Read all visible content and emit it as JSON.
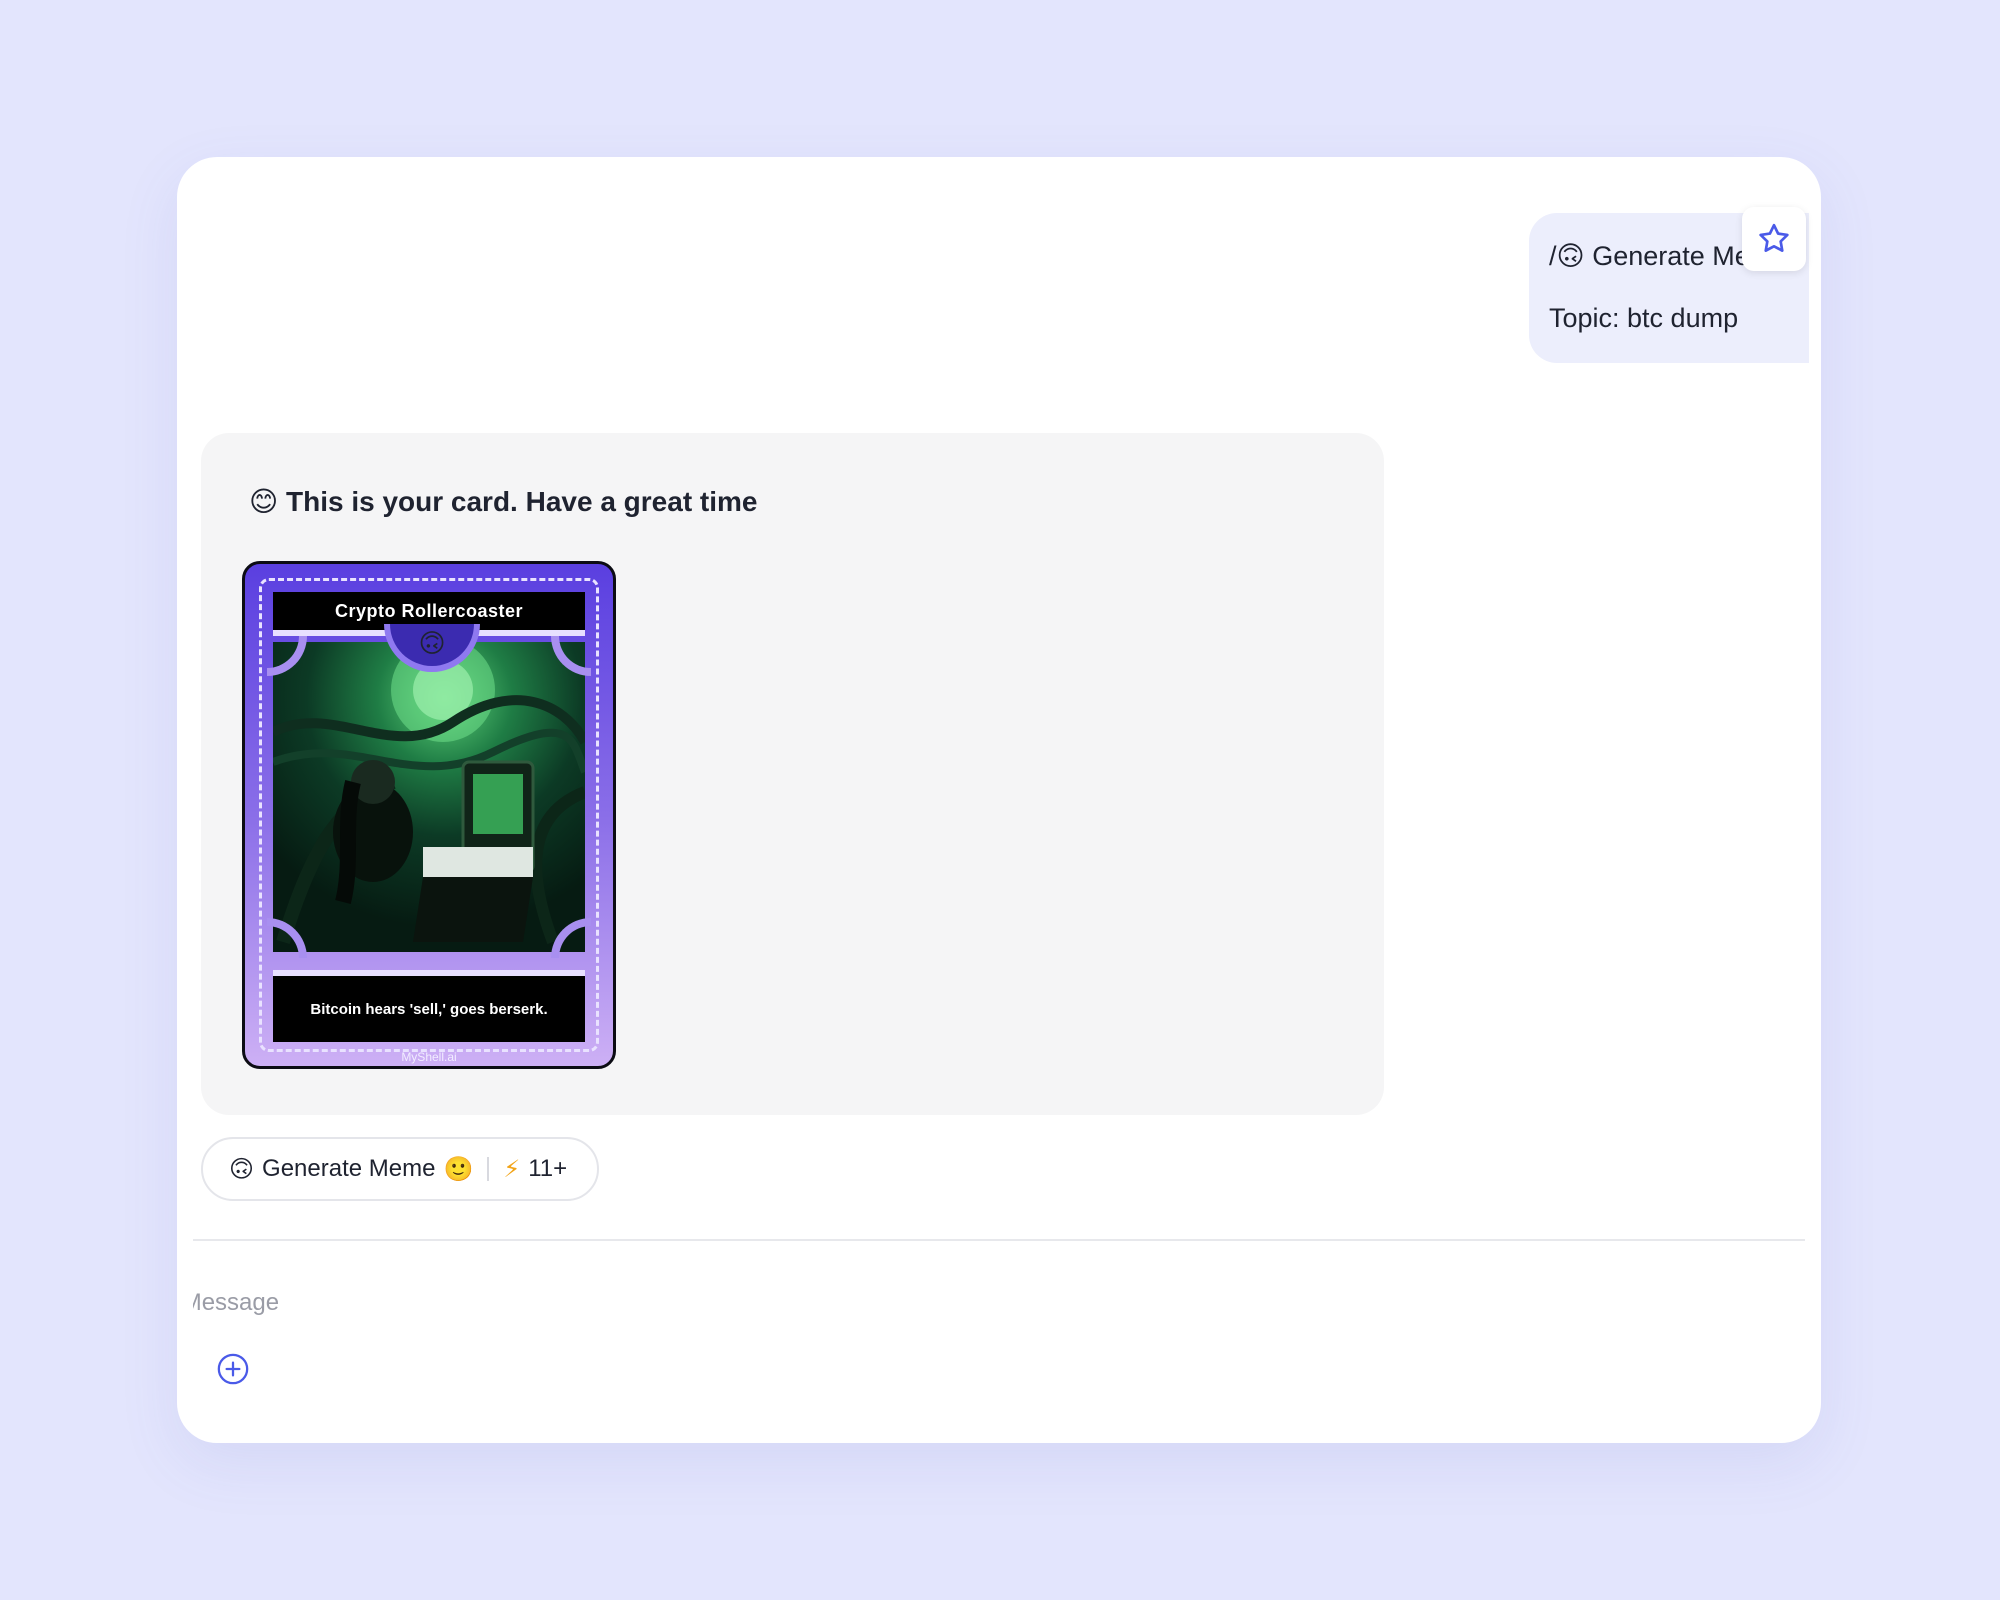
{
  "user_message": {
    "command_prefix": "/",
    "command_emoji": "🙃",
    "command_text": "Generate Meme",
    "topic_line": "Topic: btc dump"
  },
  "star_button": {
    "icon": "star-icon"
  },
  "bot_message": {
    "emoji": "😊",
    "text": "This is your card. Have a great time",
    "card": {
      "title": "Crypto Rollercoaster",
      "emblem_emoji": "🙃",
      "caption": "Bitcoin hears 'sell,' goes berserk.",
      "watermark": "MyShell.ai"
    }
  },
  "chip": {
    "emoji_left": "🙃",
    "label": "Generate Meme",
    "emoji_right": "🙂",
    "cost_icon": "⚡",
    "cost": "11+"
  },
  "composer": {
    "placeholder": "Type a Message",
    "add_icon": "plus-circle-icon"
  },
  "colors": {
    "background": "#e3e5fd",
    "accent": "#4a5ae8",
    "user_bubble": "#eceefc",
    "bot_bubble": "#f5f5f6"
  }
}
